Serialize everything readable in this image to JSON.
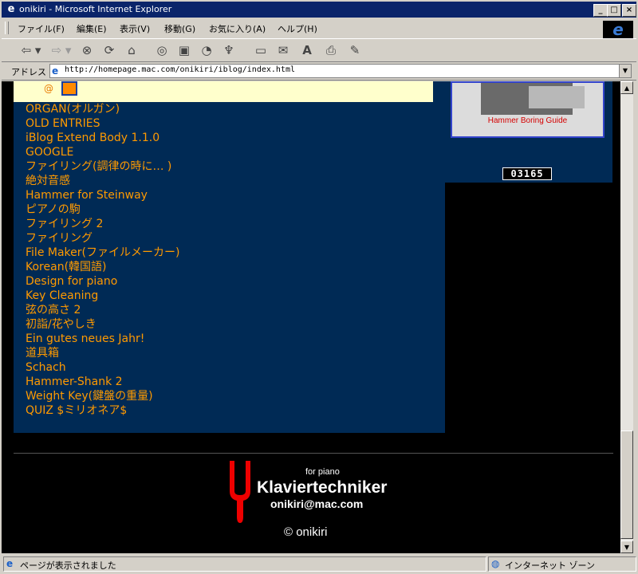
{
  "window": {
    "title": "onikiri - Microsoft Internet Explorer",
    "icon": "ie-page-icon",
    "min_label": "_",
    "max_label": "□",
    "close_label": "×"
  },
  "menu": [
    "ファイル(F)",
    "編集(E)",
    "表示(V)",
    "移動(G)",
    "お気に入り(A)",
    "ヘルプ(H)"
  ],
  "toolbar": {
    "icons": [
      "back-icon",
      "forward-icon",
      "stop-icon",
      "refresh-icon",
      "home-icon",
      "search-icon",
      "favorites-icon",
      "history-icon",
      "channels-icon",
      "fullscreen-icon",
      "mail-icon",
      "font-icon",
      "print-icon",
      "edit-icon"
    ]
  },
  "address": {
    "label": "アドレス",
    "url": "http://homepage.mac.com/onikiri/iblog/index.html"
  },
  "page": {
    "links": [
      "ORGAN(オルガン)",
      "OLD ENTRIES",
      "iBlog Extend Body 1.1.0",
      "GOOGLE",
      "ファイリング(調律の時に… )",
      "絶対音感",
      "Hammer for Steinway",
      "ピアノの駒",
      "ファイリング 2",
      "ファイリング",
      "File Maker(ファイルメーカー)",
      "Korean(韓国語)",
      "Design for piano",
      "Key Cleaning",
      "弦の高さ 2",
      "初詣/花やしき",
      "Ein gutes neues Jahr!",
      "道具箱",
      "Schach",
      "Hammer-Shank 2",
      "Weight Key(鍵盤の重量)",
      "QUIZ $ミリオネア$"
    ],
    "banner_caption": "Hammer Boring Guide",
    "counter": "03165",
    "footer": {
      "for_piano": "for piano",
      "title": "Klaviertechniker",
      "email": "onikiri@mac.com",
      "copyright": "© onikiri"
    },
    "colors": {
      "link": "#ff9a00",
      "panel": "#002a55",
      "fork": "#ee0000"
    }
  },
  "status": {
    "left": "ページが表示されました",
    "right": "インターネット ゾーン"
  }
}
